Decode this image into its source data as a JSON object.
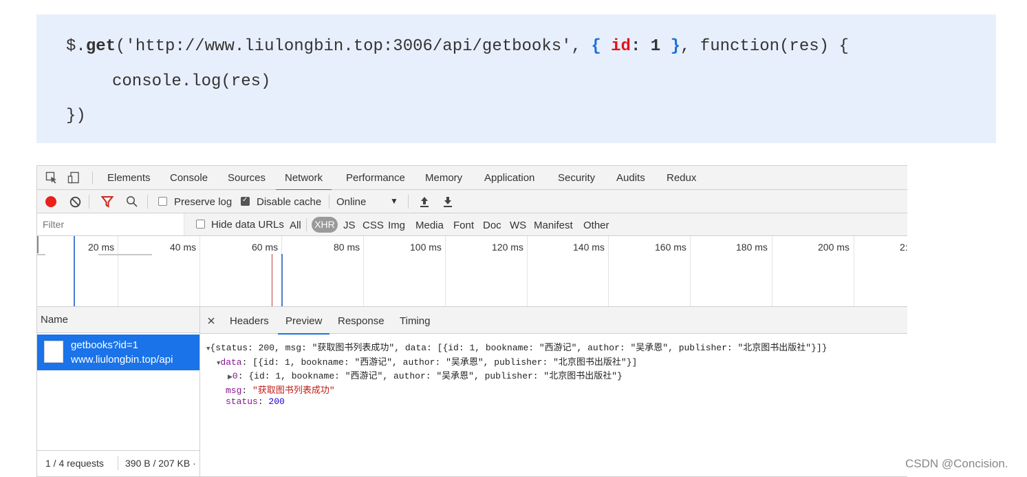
{
  "code": {
    "line1": {
      "prefix": "$.",
      "method": "get",
      "mid": "('http://www.liulongbin.top:3006/api/getbooks', ",
      "brace_open": "{",
      "key": "id",
      "colon": ": ",
      "value": "1",
      "brace_close": "}",
      "suffix": ", function(res) {"
    },
    "line2": "console.log(res)",
    "line3": "})"
  },
  "devtools": {
    "tabs": [
      "Elements",
      "Console",
      "Sources",
      "Network",
      "Performance",
      "Memory",
      "Application",
      "Security",
      "Audits",
      "Redux"
    ],
    "active_tab": "Network",
    "toolbar": {
      "preserve_log": "Preserve log",
      "disable_cache": "Disable cache",
      "throttle": "Online",
      "throttle_arrow": "▼",
      "upload_icon": "upload-icon",
      "download_icon": "download-icon"
    },
    "filter": {
      "placeholder": "Filter",
      "hide_data_urls": "Hide data URLs",
      "types": [
        "All",
        "XHR",
        "JS",
        "CSS",
        "Img",
        "Media",
        "Font",
        "Doc",
        "WS",
        "Manifest",
        "Other"
      ],
      "active_type": "XHR"
    },
    "timeline_ticks": [
      "20 ms",
      "40 ms",
      "60 ms",
      "80 ms",
      "100 ms",
      "120 ms",
      "140 ms",
      "160 ms",
      "180 ms",
      "200 ms",
      "2:"
    ],
    "name_header": "Name",
    "request": {
      "name": "getbooks?id=1",
      "host": "www.liulongbin.top/api"
    },
    "status": {
      "requests": "1 / 4 requests",
      "size": "390 B / 207 KB ·"
    },
    "panel_tabs": [
      "Headers",
      "Preview",
      "Response",
      "Timing"
    ],
    "active_panel_tab": "Preview",
    "preview": {
      "line1": "{status: 200, msg: \"获取图书列表成功\", data: [{id: 1, bookname: \"西游记\", author: \"吴承恩\", publisher: \"北京图书出版社\"}]}",
      "data_key": "data",
      "data_value": ": [{id: 1, bookname: \"西游记\", author: \"吴承恩\", publisher: \"北京图书出版社\"}]",
      "item_key": "0",
      "item_value": ": {id: 1, bookname: \"西游记\", author: \"吴承恩\", publisher: \"北京图书出版社\"}",
      "msg_key": "msg",
      "msg_value": "\"获取图书列表成功\"",
      "status_key": "status",
      "status_value": "200"
    }
  },
  "watermark": "CSDN @Concision."
}
